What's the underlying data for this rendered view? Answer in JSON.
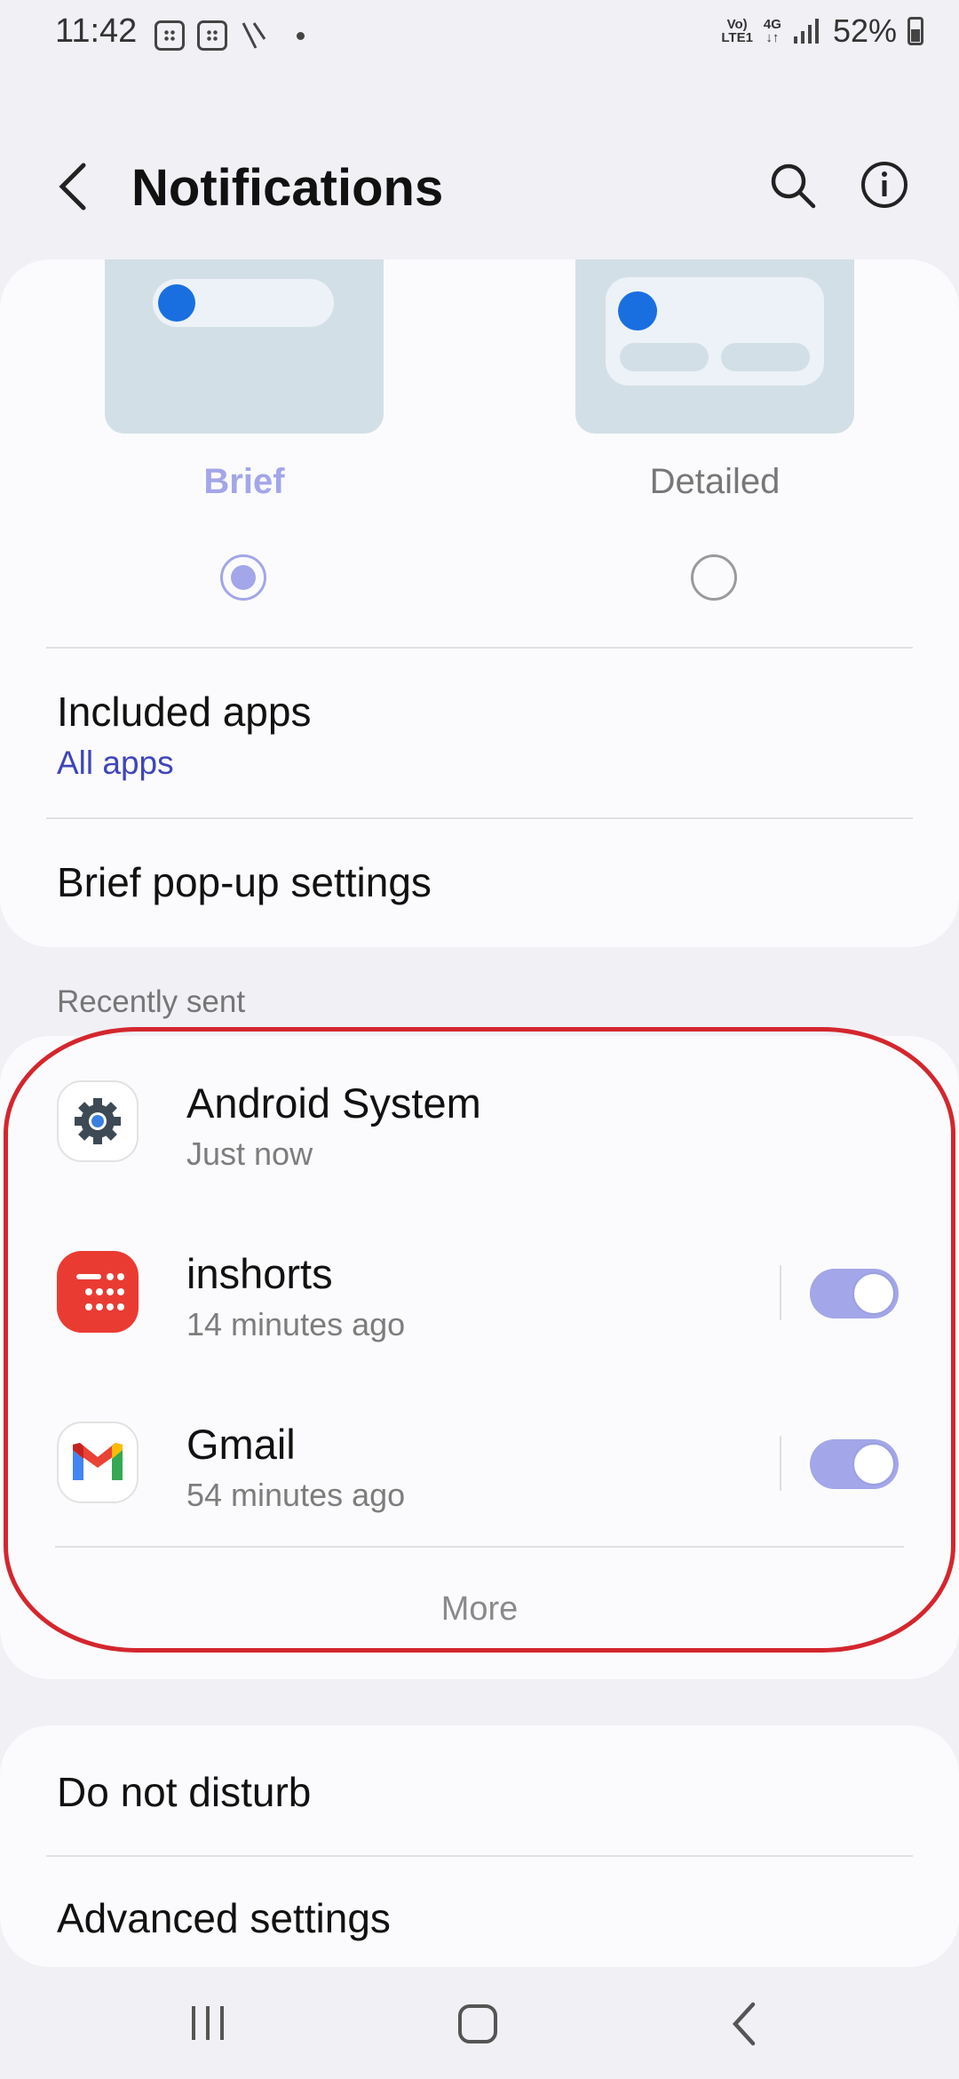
{
  "status_bar": {
    "time": "11:42",
    "network_top": "Vo)",
    "network_bottom": "LTE1",
    "network_type": "4G",
    "battery": "52%"
  },
  "header": {
    "title": "Notifications",
    "back_icon": "back-arrow-icon",
    "search_icon": "search-icon",
    "info_icon": "info-icon"
  },
  "popup_style": {
    "options": [
      {
        "label": "Brief",
        "selected": true
      },
      {
        "label": "Detailed",
        "selected": false
      }
    ]
  },
  "included_apps": {
    "title": "Included apps",
    "value": "All apps"
  },
  "brief_popup": {
    "title": "Brief pop-up settings"
  },
  "recently_sent": {
    "section_label": "Recently sent",
    "apps": [
      {
        "name": "Android System",
        "time": "Just now",
        "icon": "android-system-gear-icon"
      },
      {
        "name": "inshorts",
        "time": "14 minutes ago",
        "icon": "inshorts-icon",
        "toggle_on": true
      },
      {
        "name": "Gmail",
        "time": "54 minutes ago",
        "icon": "gmail-icon",
        "toggle_on": true
      }
    ],
    "more_label": "More"
  },
  "other_settings": {
    "dnd": "Do not disturb",
    "advanced": "Advanced settings"
  },
  "colors": {
    "accent": "#a3a6e8",
    "link": "#3f45b9",
    "highlight": "#d4262e",
    "blue_dot": "#1a6fe0"
  }
}
